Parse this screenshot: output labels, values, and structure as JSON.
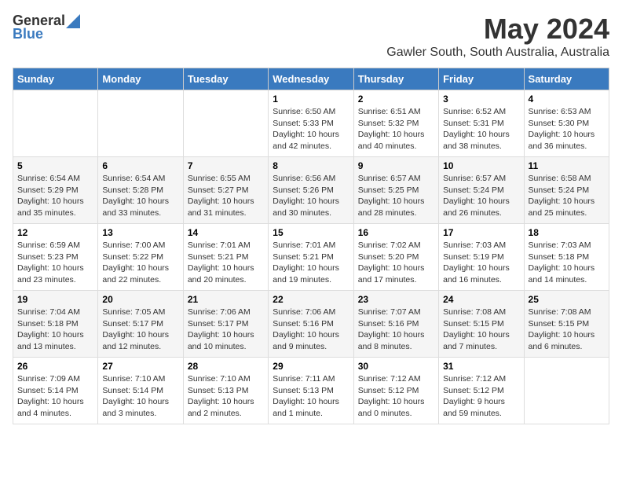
{
  "header": {
    "logo_general": "General",
    "logo_blue": "Blue",
    "month_title": "May 2024",
    "location": "Gawler South, South Australia, Australia"
  },
  "weekdays": [
    "Sunday",
    "Monday",
    "Tuesday",
    "Wednesday",
    "Thursday",
    "Friday",
    "Saturday"
  ],
  "weeks": [
    [
      {
        "day": "",
        "info": ""
      },
      {
        "day": "",
        "info": ""
      },
      {
        "day": "",
        "info": ""
      },
      {
        "day": "1",
        "info": "Sunrise: 6:50 AM\nSunset: 5:33 PM\nDaylight: 10 hours\nand 42 minutes."
      },
      {
        "day": "2",
        "info": "Sunrise: 6:51 AM\nSunset: 5:32 PM\nDaylight: 10 hours\nand 40 minutes."
      },
      {
        "day": "3",
        "info": "Sunrise: 6:52 AM\nSunset: 5:31 PM\nDaylight: 10 hours\nand 38 minutes."
      },
      {
        "day": "4",
        "info": "Sunrise: 6:53 AM\nSunset: 5:30 PM\nDaylight: 10 hours\nand 36 minutes."
      }
    ],
    [
      {
        "day": "5",
        "info": "Sunrise: 6:54 AM\nSunset: 5:29 PM\nDaylight: 10 hours\nand 35 minutes."
      },
      {
        "day": "6",
        "info": "Sunrise: 6:54 AM\nSunset: 5:28 PM\nDaylight: 10 hours\nand 33 minutes."
      },
      {
        "day": "7",
        "info": "Sunrise: 6:55 AM\nSunset: 5:27 PM\nDaylight: 10 hours\nand 31 minutes."
      },
      {
        "day": "8",
        "info": "Sunrise: 6:56 AM\nSunset: 5:26 PM\nDaylight: 10 hours\nand 30 minutes."
      },
      {
        "day": "9",
        "info": "Sunrise: 6:57 AM\nSunset: 5:25 PM\nDaylight: 10 hours\nand 28 minutes."
      },
      {
        "day": "10",
        "info": "Sunrise: 6:57 AM\nSunset: 5:24 PM\nDaylight: 10 hours\nand 26 minutes."
      },
      {
        "day": "11",
        "info": "Sunrise: 6:58 AM\nSunset: 5:24 PM\nDaylight: 10 hours\nand 25 minutes."
      }
    ],
    [
      {
        "day": "12",
        "info": "Sunrise: 6:59 AM\nSunset: 5:23 PM\nDaylight: 10 hours\nand 23 minutes."
      },
      {
        "day": "13",
        "info": "Sunrise: 7:00 AM\nSunset: 5:22 PM\nDaylight: 10 hours\nand 22 minutes."
      },
      {
        "day": "14",
        "info": "Sunrise: 7:01 AM\nSunset: 5:21 PM\nDaylight: 10 hours\nand 20 minutes."
      },
      {
        "day": "15",
        "info": "Sunrise: 7:01 AM\nSunset: 5:21 PM\nDaylight: 10 hours\nand 19 minutes."
      },
      {
        "day": "16",
        "info": "Sunrise: 7:02 AM\nSunset: 5:20 PM\nDaylight: 10 hours\nand 17 minutes."
      },
      {
        "day": "17",
        "info": "Sunrise: 7:03 AM\nSunset: 5:19 PM\nDaylight: 10 hours\nand 16 minutes."
      },
      {
        "day": "18",
        "info": "Sunrise: 7:03 AM\nSunset: 5:18 PM\nDaylight: 10 hours\nand 14 minutes."
      }
    ],
    [
      {
        "day": "19",
        "info": "Sunrise: 7:04 AM\nSunset: 5:18 PM\nDaylight: 10 hours\nand 13 minutes."
      },
      {
        "day": "20",
        "info": "Sunrise: 7:05 AM\nSunset: 5:17 PM\nDaylight: 10 hours\nand 12 minutes."
      },
      {
        "day": "21",
        "info": "Sunrise: 7:06 AM\nSunset: 5:17 PM\nDaylight: 10 hours\nand 10 minutes."
      },
      {
        "day": "22",
        "info": "Sunrise: 7:06 AM\nSunset: 5:16 PM\nDaylight: 10 hours\nand 9 minutes."
      },
      {
        "day": "23",
        "info": "Sunrise: 7:07 AM\nSunset: 5:16 PM\nDaylight: 10 hours\nand 8 minutes."
      },
      {
        "day": "24",
        "info": "Sunrise: 7:08 AM\nSunset: 5:15 PM\nDaylight: 10 hours\nand 7 minutes."
      },
      {
        "day": "25",
        "info": "Sunrise: 7:08 AM\nSunset: 5:15 PM\nDaylight: 10 hours\nand 6 minutes."
      }
    ],
    [
      {
        "day": "26",
        "info": "Sunrise: 7:09 AM\nSunset: 5:14 PM\nDaylight: 10 hours\nand 4 minutes."
      },
      {
        "day": "27",
        "info": "Sunrise: 7:10 AM\nSunset: 5:14 PM\nDaylight: 10 hours\nand 3 minutes."
      },
      {
        "day": "28",
        "info": "Sunrise: 7:10 AM\nSunset: 5:13 PM\nDaylight: 10 hours\nand 2 minutes."
      },
      {
        "day": "29",
        "info": "Sunrise: 7:11 AM\nSunset: 5:13 PM\nDaylight: 10 hours\nand 1 minute."
      },
      {
        "day": "30",
        "info": "Sunrise: 7:12 AM\nSunset: 5:12 PM\nDaylight: 10 hours\nand 0 minutes."
      },
      {
        "day": "31",
        "info": "Sunrise: 7:12 AM\nSunset: 5:12 PM\nDaylight: 9 hours\nand 59 minutes."
      },
      {
        "day": "",
        "info": ""
      }
    ]
  ]
}
